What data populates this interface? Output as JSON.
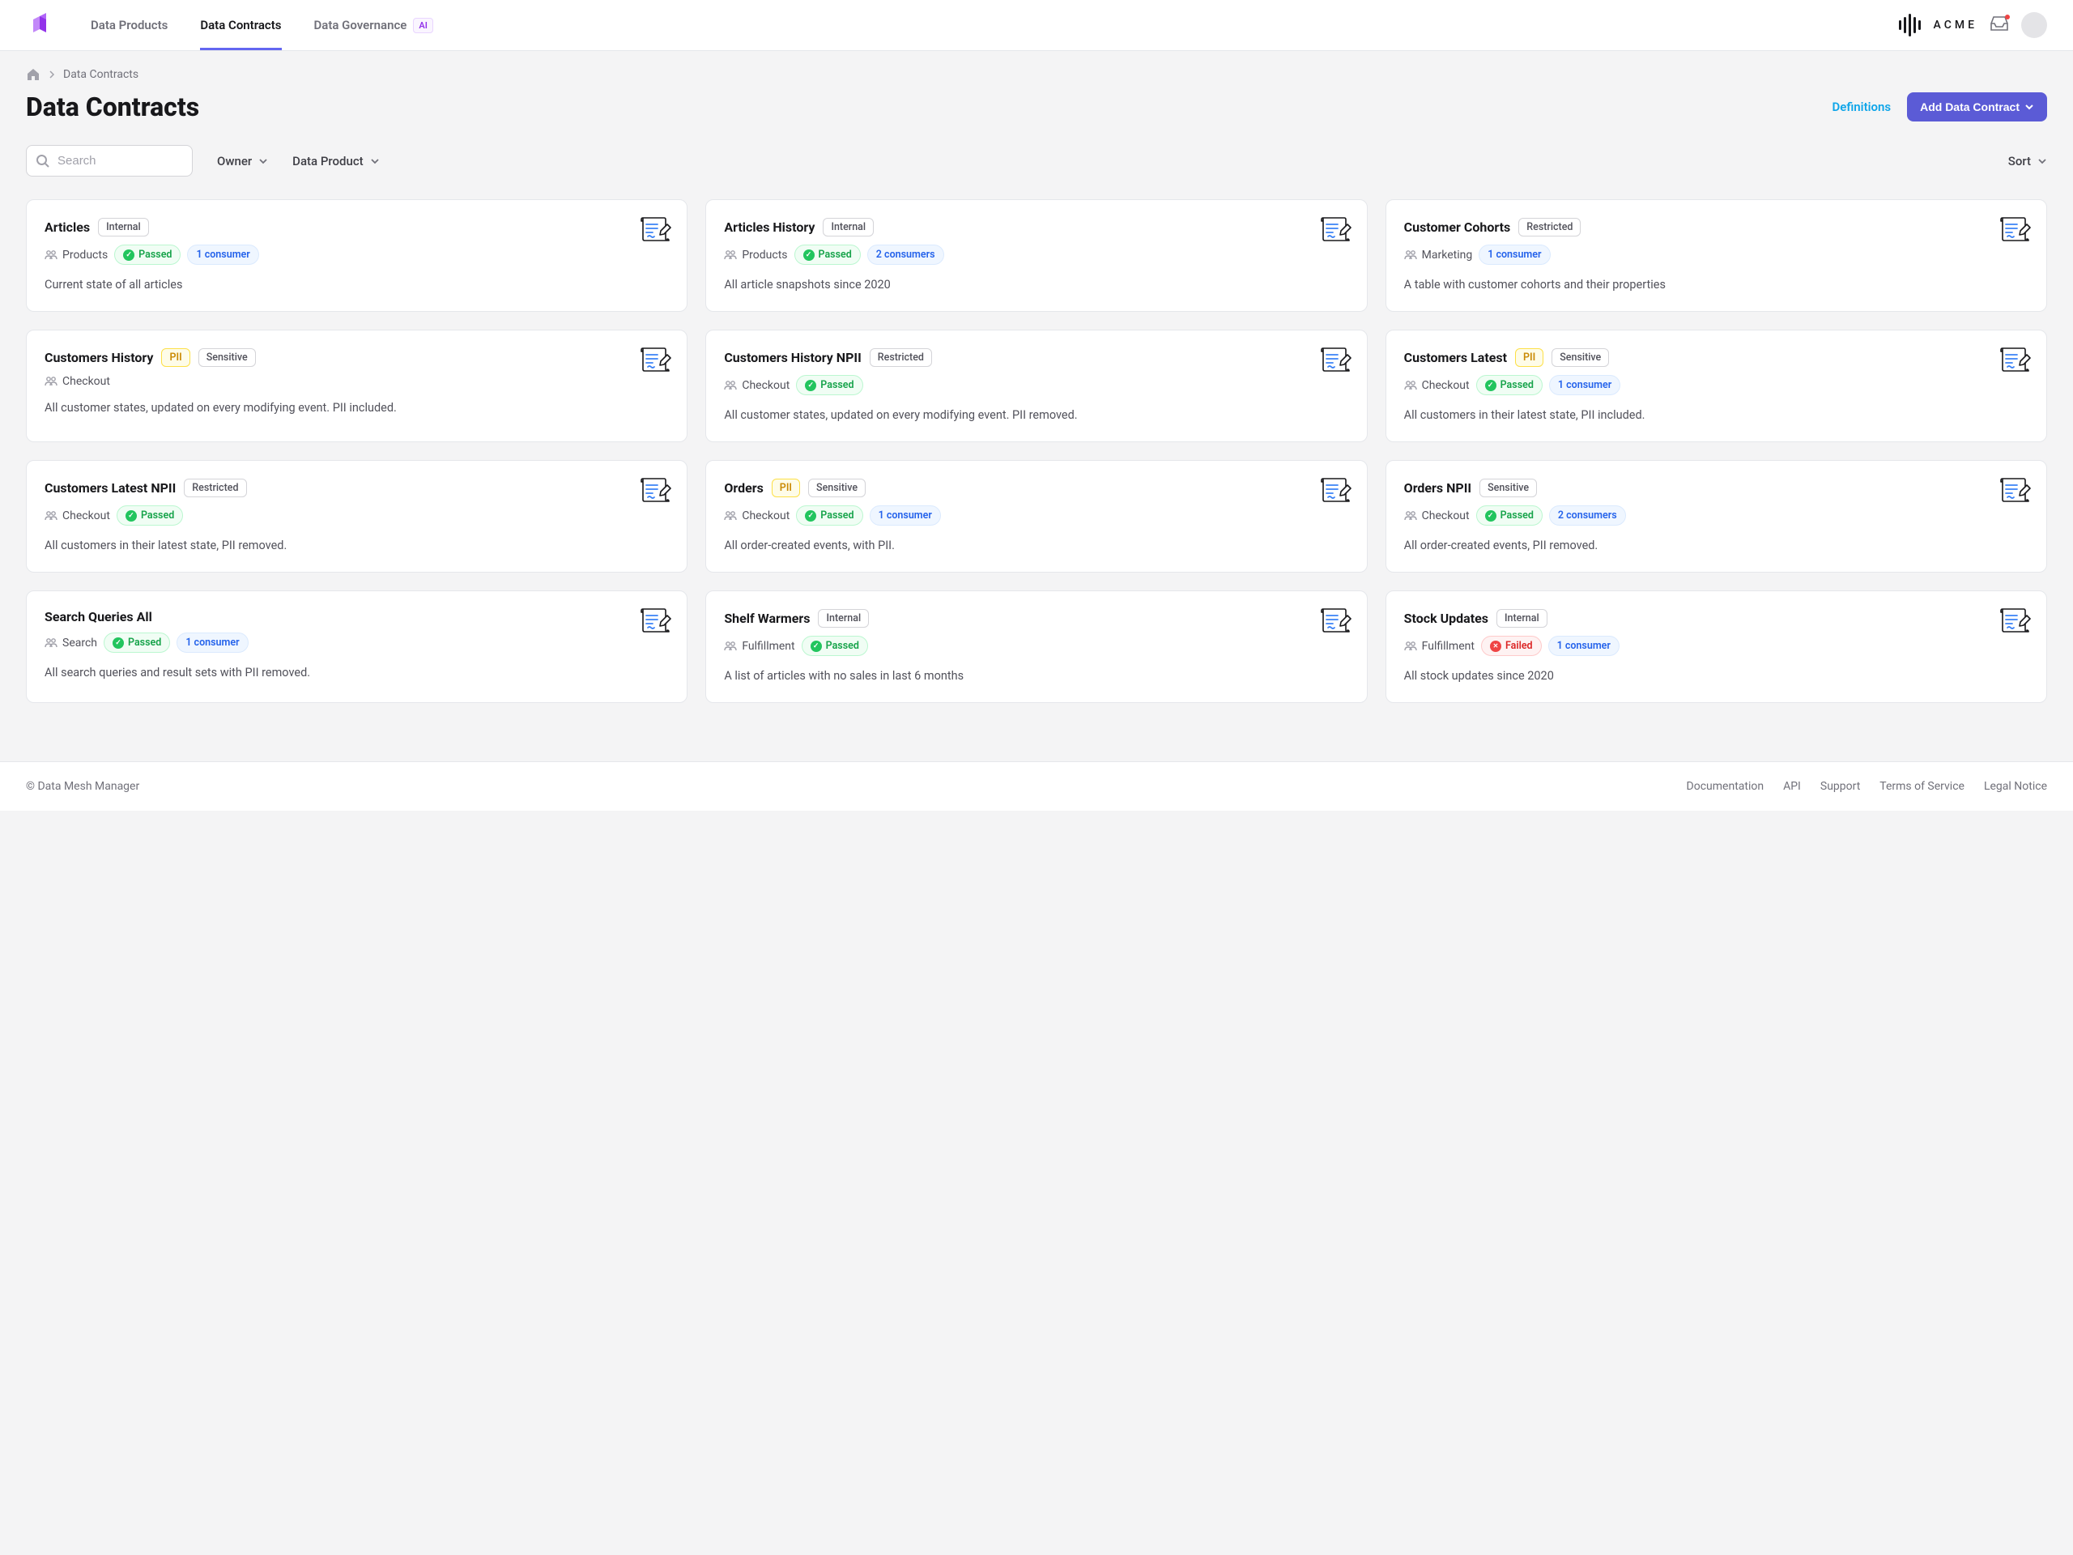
{
  "nav": {
    "tabs": [
      "Data Products",
      "Data Contracts",
      "Data Governance"
    ],
    "ai_badge": "AI",
    "org": "ACME"
  },
  "breadcrumb": {
    "current": "Data Contracts"
  },
  "page": {
    "title": "Data Contracts",
    "definitions": "Definitions",
    "add_button": "Add Data Contract"
  },
  "filters": {
    "search_placeholder": "Search",
    "owner": "Owner",
    "data_product": "Data Product",
    "sort": "Sort"
  },
  "cards": [
    {
      "title": "Articles",
      "tags": [
        {
          "type": "internal",
          "text": "Internal"
        }
      ],
      "team": "Products",
      "status": {
        "type": "passed",
        "text": "Passed"
      },
      "consumers": "1 consumer",
      "desc": "Current state of all articles"
    },
    {
      "title": "Articles History",
      "tags": [
        {
          "type": "internal",
          "text": "Internal"
        }
      ],
      "team": "Products",
      "status": {
        "type": "passed",
        "text": "Passed"
      },
      "consumers": "2 consumers",
      "desc": "All article snapshots since 2020"
    },
    {
      "title": "Customer Cohorts",
      "tags": [
        {
          "type": "restricted",
          "text": "Restricted"
        }
      ],
      "team": "Marketing",
      "status": null,
      "consumers": "1 consumer",
      "desc": "A table with customer cohorts and their properties"
    },
    {
      "title": "Customers History",
      "tags": [
        {
          "type": "pii",
          "text": "PII"
        },
        {
          "type": "sensitive",
          "text": "Sensitive"
        }
      ],
      "team": "Checkout",
      "status": null,
      "consumers": null,
      "desc": "All customer states, updated on every modifying event. PII included."
    },
    {
      "title": "Customers History NPII",
      "tags": [
        {
          "type": "restricted",
          "text": "Restricted"
        }
      ],
      "team": "Checkout",
      "status": {
        "type": "passed",
        "text": "Passed"
      },
      "consumers": null,
      "desc": "All customer states, updated on every modifying event. PII removed."
    },
    {
      "title": "Customers Latest",
      "tags": [
        {
          "type": "pii",
          "text": "PII"
        },
        {
          "type": "sensitive",
          "text": "Sensitive"
        }
      ],
      "team": "Checkout",
      "status": {
        "type": "passed",
        "text": "Passed"
      },
      "consumers": "1 consumer",
      "desc": "All customers in their latest state, PII included."
    },
    {
      "title": "Customers Latest NPII",
      "tags": [
        {
          "type": "restricted",
          "text": "Restricted"
        }
      ],
      "team": "Checkout",
      "status": {
        "type": "passed",
        "text": "Passed"
      },
      "consumers": null,
      "desc": "All customers in their latest state, PII removed."
    },
    {
      "title": "Orders",
      "tags": [
        {
          "type": "pii",
          "text": "PII"
        },
        {
          "type": "sensitive",
          "text": "Sensitive"
        }
      ],
      "team": "Checkout",
      "status": {
        "type": "passed",
        "text": "Passed"
      },
      "consumers": "1 consumer",
      "desc": "All order-created events, with PII."
    },
    {
      "title": "Orders NPII",
      "tags": [
        {
          "type": "sensitive",
          "text": "Sensitive"
        }
      ],
      "team": "Checkout",
      "status": {
        "type": "passed",
        "text": "Passed"
      },
      "consumers": "2 consumers",
      "desc": "All order-created events, PII removed."
    },
    {
      "title": "Search Queries All",
      "tags": [],
      "team": "Search",
      "status": {
        "type": "passed",
        "text": "Passed"
      },
      "consumers": "1 consumer",
      "desc": "All search queries and result sets with PII removed."
    },
    {
      "title": "Shelf Warmers",
      "tags": [
        {
          "type": "internal",
          "text": "Internal"
        }
      ],
      "team": "Fulfillment",
      "status": {
        "type": "passed",
        "text": "Passed"
      },
      "consumers": null,
      "desc": "A list of articles with no sales in last 6 months"
    },
    {
      "title": "Stock Updates",
      "tags": [
        {
          "type": "internal",
          "text": "Internal"
        }
      ],
      "team": "Fulfillment",
      "status": {
        "type": "failed",
        "text": "Failed"
      },
      "consumers": "1 consumer",
      "desc": "All stock updates since 2020"
    }
  ],
  "footer": {
    "copyright": "© Data Mesh Manager",
    "links": [
      "Documentation",
      "API",
      "Support",
      "Terms of Service",
      "Legal Notice"
    ]
  }
}
